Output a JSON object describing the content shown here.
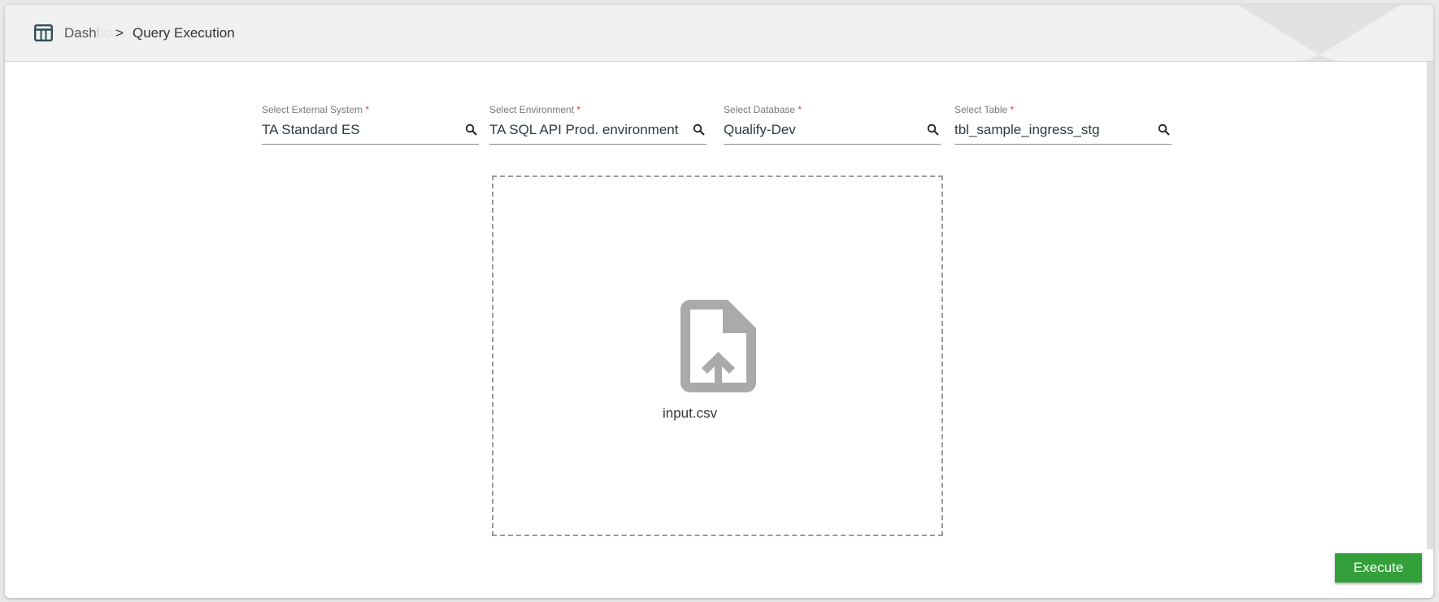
{
  "breadcrumb": {
    "root": "Dashboard",
    "separator": ">",
    "current": "Query Execution"
  },
  "fields": [
    {
      "label": "Select External System",
      "required": "*",
      "value": "TA Standard ES"
    },
    {
      "label": "Select Environment",
      "required": "*",
      "value": "TA SQL API Prod. environment"
    },
    {
      "label": "Select Database",
      "required": "*",
      "value": "Qualify-Dev"
    },
    {
      "label": "Select Table",
      "required": "*",
      "value": "tbl_sample_ingress_stg"
    }
  ],
  "upload": {
    "file_name": "input.csv"
  },
  "actions": {
    "execute_label": "Execute"
  },
  "colors": {
    "accent": "#33a03a",
    "required": "#e53935"
  }
}
